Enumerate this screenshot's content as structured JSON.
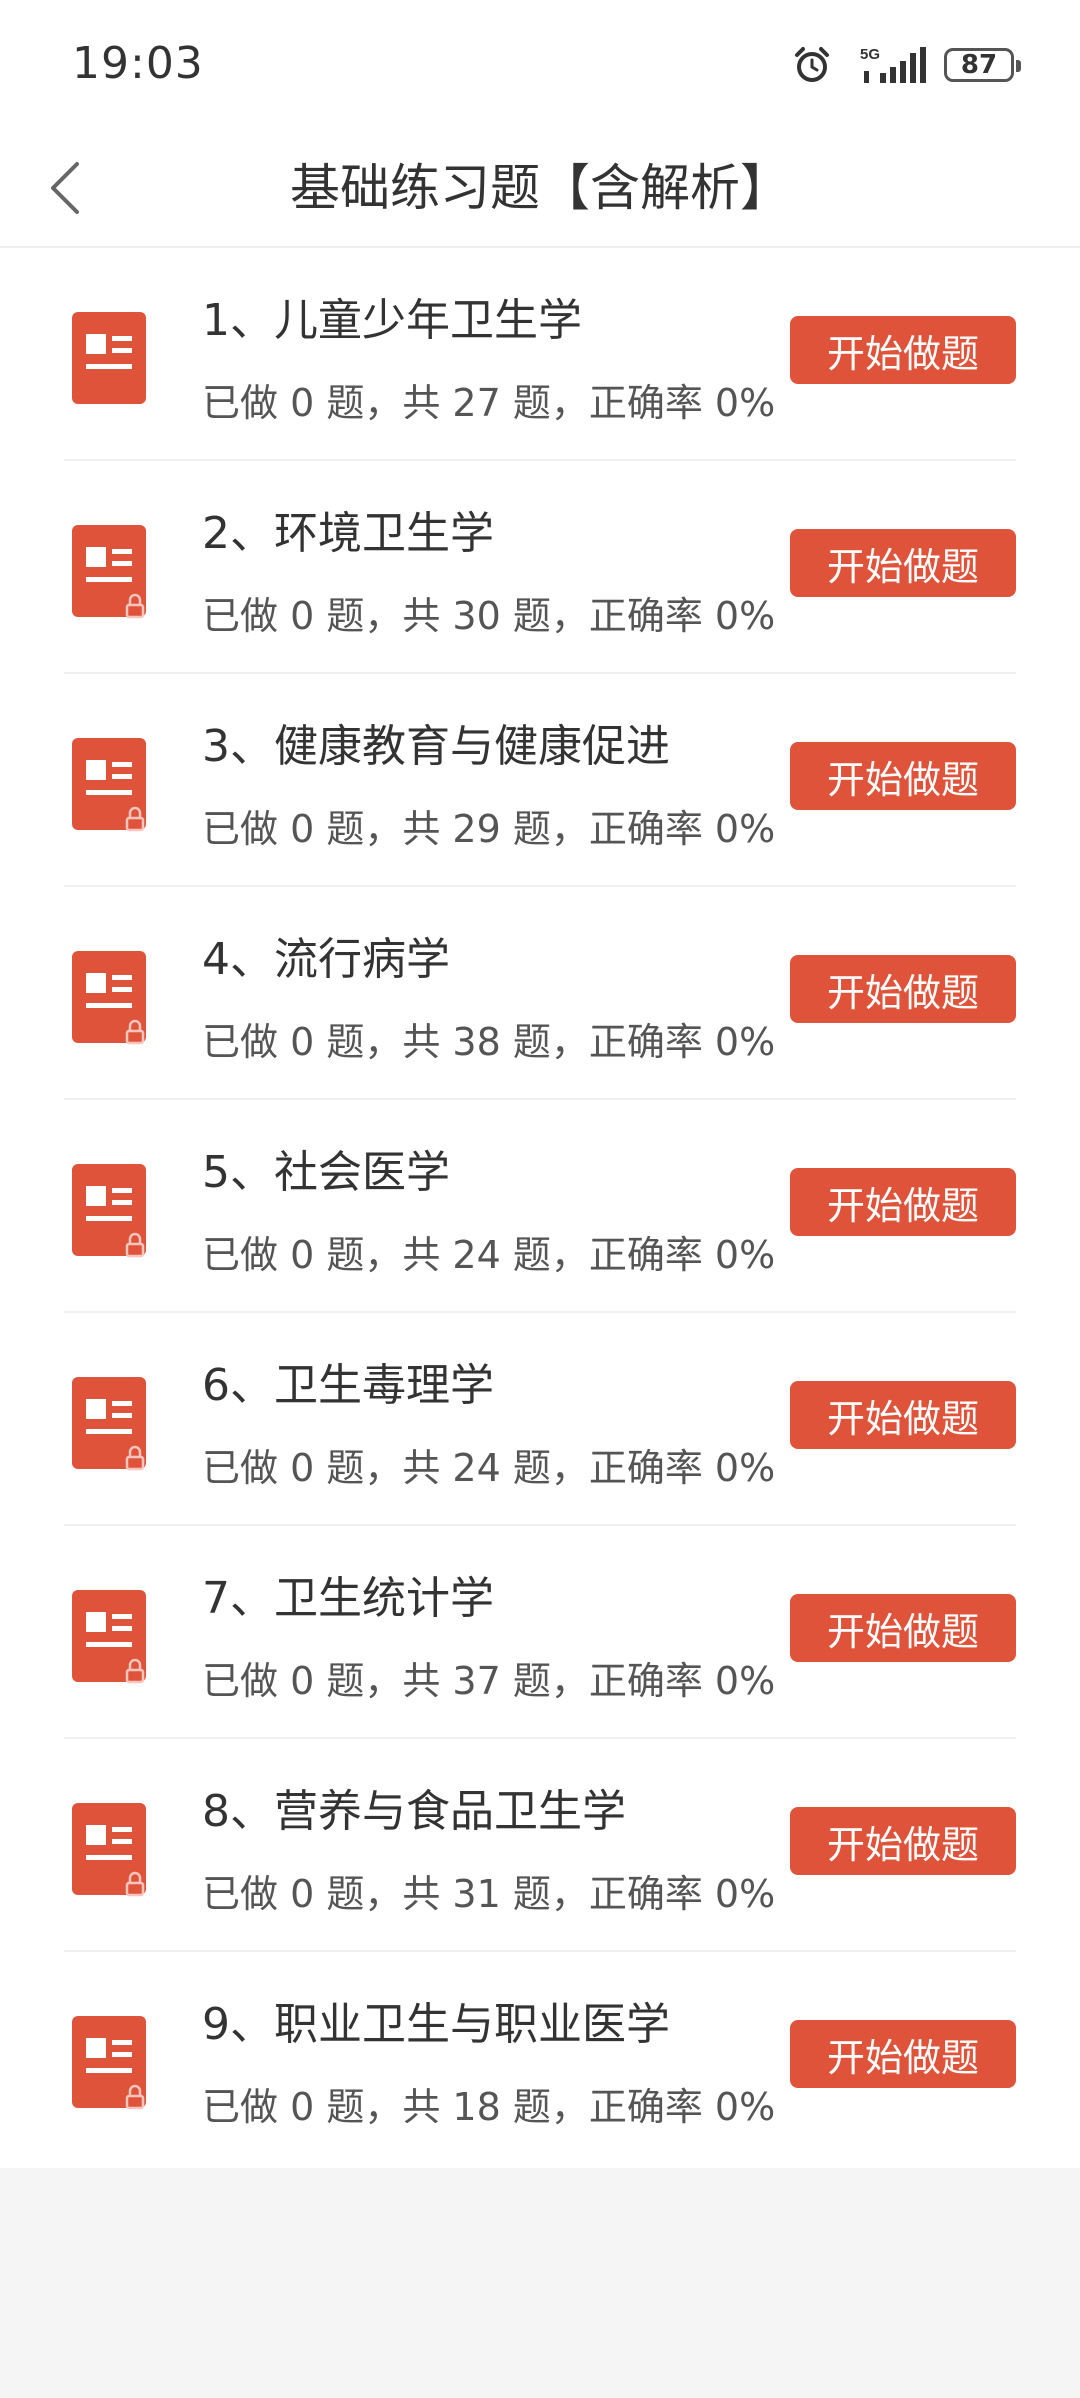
{
  "status": {
    "time": "19:03",
    "network": "5G",
    "battery": "87"
  },
  "header": {
    "title": "基础练习题【含解析】"
  },
  "colors": {
    "accent": "#e0533b",
    "lock": "#f6c5bb"
  },
  "items": [
    {
      "title": "1、儿童少年卫生学",
      "stats": "已做 0 题，共 27 题，正确率 0%",
      "button": "开始做题",
      "locked": false
    },
    {
      "title": "2、环境卫生学",
      "stats": "已做 0 题，共 30 题，正确率 0%",
      "button": "开始做题",
      "locked": true
    },
    {
      "title": "3、健康教育与健康促进",
      "stats": "已做 0 题，共 29 题，正确率 0%",
      "button": "开始做题",
      "locked": true
    },
    {
      "title": "4、流行病学",
      "stats": "已做 0 题，共 38 题，正确率 0%",
      "button": "开始做题",
      "locked": true
    },
    {
      "title": "5、社会医学",
      "stats": "已做 0 题，共 24 题，正确率 0%",
      "button": "开始做题",
      "locked": true
    },
    {
      "title": "6、卫生毒理学",
      "stats": "已做 0 题，共 24 题，正确率 0%",
      "button": "开始做题",
      "locked": true
    },
    {
      "title": "7、卫生统计学",
      "stats": "已做 0 题，共 37 题，正确率 0%",
      "button": "开始做题",
      "locked": true
    },
    {
      "title": "8、营养与食品卫生学",
      "stats": "已做 0 题，共 31 题，正确率 0%",
      "button": "开始做题",
      "locked": true
    },
    {
      "title": "9、职业卫生与职业医学",
      "stats": "已做 0 题，共 18 题，正确率 0%",
      "button": "开始做题",
      "locked": true
    }
  ]
}
